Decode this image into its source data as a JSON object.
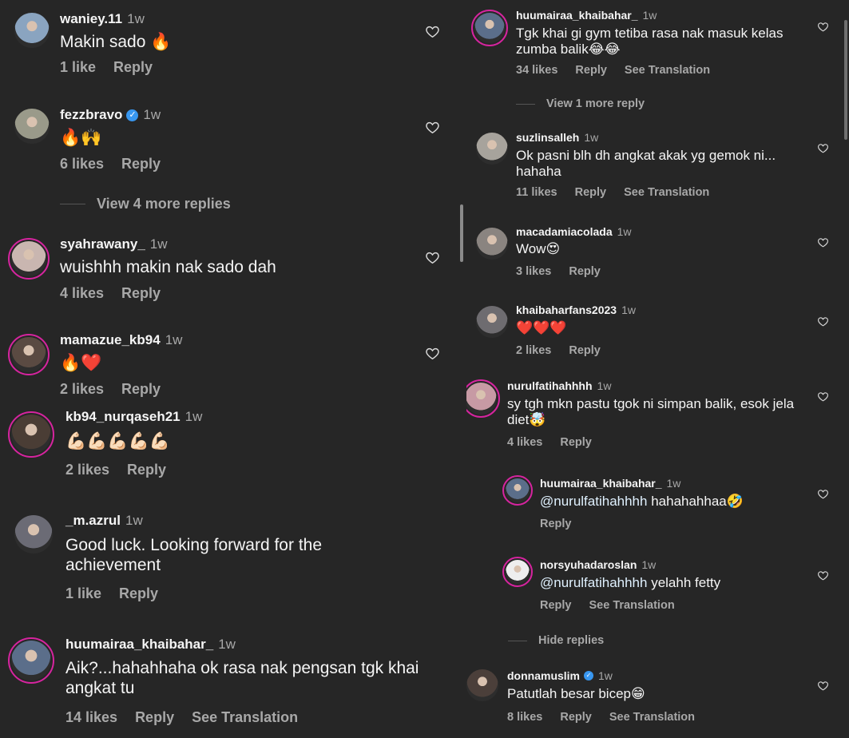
{
  "left_comments": [
    {
      "username": "waniey.11",
      "time": "1w",
      "verified": false,
      "text": "Makin sado 🔥",
      "likes": "1 like",
      "reply": "Reply",
      "translate": "",
      "avatar_color": "#8aa4c0"
    },
    {
      "username": "fezzbravo",
      "time": "1w",
      "verified": true,
      "text": "🔥🙌",
      "likes": "6 likes",
      "reply": "Reply",
      "translate": "",
      "avatar_color": "#9a9a8a"
    },
    {
      "username": "syahrawany_",
      "time": "1w",
      "verified": false,
      "text": "wuishhh makin nak sado dah",
      "likes": "4 likes",
      "reply": "Reply",
      "translate": "",
      "avatar_color": "#c9b6b0"
    },
    {
      "username": "mamazue_kb94",
      "time": "1w",
      "verified": false,
      "text": "🔥❤️",
      "likes": "2 likes",
      "reply": "Reply",
      "translate": "",
      "avatar_color": "#5a4a42"
    },
    {
      "username": "kb94_nurqaseh21",
      "time": "1w",
      "verified": false,
      "text": "💪🏻💪🏻💪🏻💪🏻💪🏻",
      "likes": "2 likes",
      "reply": "Reply",
      "translate": "",
      "avatar_color": "#4a3d35"
    },
    {
      "username": "_m.azrul",
      "time": "1w",
      "verified": false,
      "text": "Good luck. Looking forward for the achievement",
      "likes": "1 like",
      "reply": "Reply",
      "translate": "",
      "avatar_color": "#6b6b75"
    },
    {
      "username": "huumairaa_khaibahar_",
      "time": "1w",
      "verified": false,
      "text": "Aik?...hahahhaha ok rasa nak pengsan tgk khai angkat tu",
      "likes": "14 likes",
      "reply": "Reply",
      "translate": "See Translation",
      "avatar_color": "#5b6e8a"
    }
  ],
  "left_view_more": "View 4 more replies",
  "right_comments": [
    {
      "username": "huumairaa_khaibahar_",
      "time": "1w",
      "verified": false,
      "text": "Tgk khai gi gym tetiba rasa nak masuk kelas zumba balik😂😂",
      "likes": "34 likes",
      "reply": "Reply",
      "translate": "See Translation",
      "avatar_color": "#5b6e8a"
    },
    {
      "username": "suzlinsalleh",
      "time": "1w",
      "verified": false,
      "text": "Ok pasni blh dh angkat akak yg gemok ni... hahaha",
      "likes": "11 likes",
      "reply": "Reply",
      "translate": "See Translation",
      "avatar_color": "#a7a39c"
    },
    {
      "username": "macadamiacolada",
      "time": "1w",
      "verified": false,
      "text": "Wow😍",
      "likes": "3 likes",
      "reply": "Reply",
      "translate": "",
      "avatar_color": "#8a8480"
    },
    {
      "username": "khaibaharfans2023",
      "time": "1w",
      "verified": false,
      "text": "❤️❤️❤️",
      "likes": "2 likes",
      "reply": "Reply",
      "translate": "",
      "avatar_color": "#6e6c70"
    },
    {
      "username": "nurulfatihahhhh",
      "time": "1w",
      "verified": false,
      "text": "sy tgh mkn pastu tgok ni simpan balik, esok jela diet🤯",
      "likes": "4 likes",
      "reply": "Reply",
      "translate": "",
      "avatar_color": "#c79aa4"
    },
    {
      "username": "huumairaa_khaibahar_",
      "time": "1w",
      "verified": false,
      "mention": "@nurulfatihahhhh",
      "text": "hahahahhaa🤣",
      "likes": "",
      "reply": "Reply",
      "translate": "",
      "avatar_color": "#5b6e8a"
    },
    {
      "username": "norsyuhadaroslan",
      "time": "1w",
      "verified": false,
      "mention": "@nurulfatihahhhh",
      "text": "yelahh fetty",
      "likes": "",
      "reply": "Reply",
      "translate": "See Translation",
      "avatar_color": "#eeeeee"
    },
    {
      "username": "donnamuslim",
      "time": "1w",
      "verified": true,
      "text": "Patutlah besar bicep😁",
      "likes": "8 likes",
      "reply": "Reply",
      "translate": "See Translation",
      "avatar_color": "#4b3f3a"
    }
  ],
  "right_view_more": "View 1 more reply",
  "right_hide_replies": "Hide replies",
  "colors": {
    "background": "#262626",
    "secondary_text": "#a8a8a8",
    "verified": "#3897f0",
    "story_ring": "#d6249f"
  }
}
